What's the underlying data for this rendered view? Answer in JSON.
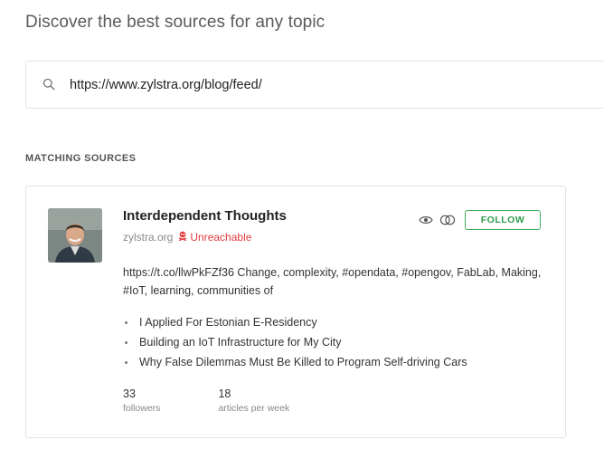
{
  "header": {
    "title": "Discover the best sources for any topic"
  },
  "search": {
    "icon": "search-icon",
    "value": "https://www.zylstra.org/blog/feed/"
  },
  "section": {
    "label": "MATCHING SOURCES"
  },
  "source": {
    "title": "Interdependent Thoughts",
    "domain": "zylstra.org",
    "status": "Unreachable",
    "status_color": "#e33b3b",
    "follow_label": "FOLLOW",
    "accent_color": "#3fae5c",
    "description": "https://t.co/llwPkFZf36 Change, complexity, #opendata, #opengov, FabLab, Making, #IoT, learning, communities of",
    "articles": [
      "I Applied For Estonian E-Residency",
      "Building an IoT Infrastructure for My City",
      "Why False Dilemmas Must Be Killed to Program Self-driving Cars"
    ],
    "stats": {
      "followers": {
        "value": "33",
        "label": "followers"
      },
      "articles_per_week": {
        "value": "18",
        "label": "articles per week"
      }
    },
    "icons": [
      "eye-icon",
      "compare-icon",
      "skull-icon"
    ]
  }
}
